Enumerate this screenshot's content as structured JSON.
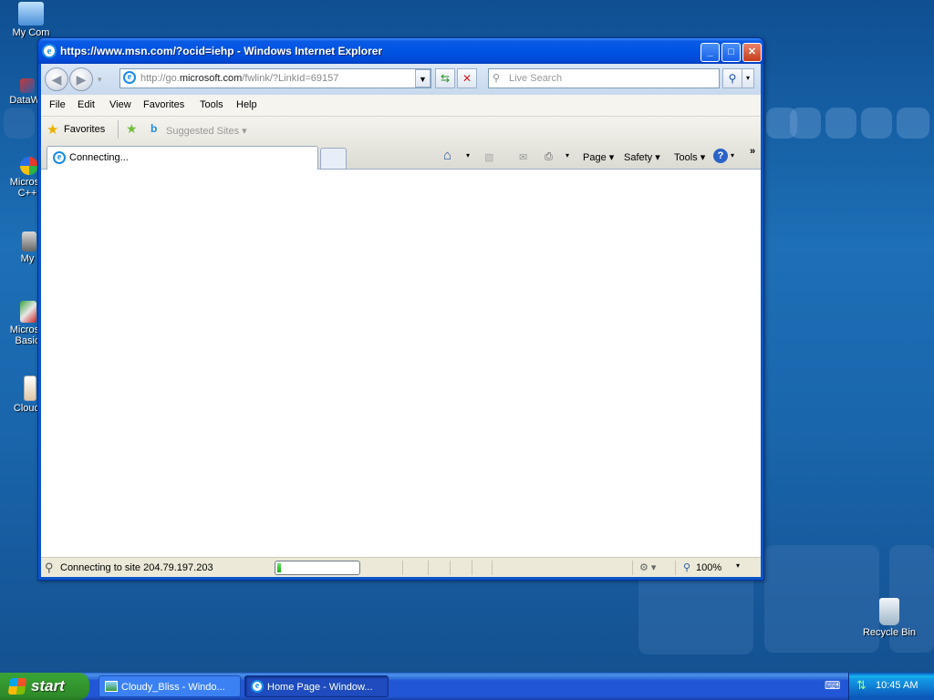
{
  "desktop": {
    "icons": [
      {
        "label": "My Com"
      },
      {
        "label": "DataWa"
      },
      {
        "label": "Microso C++"
      },
      {
        "label": "My"
      },
      {
        "label": "Microso Basic"
      },
      {
        "label": "Cloudy"
      }
    ],
    "recycle_bin": "Recycle Bin"
  },
  "window": {
    "title": "https://www.msn.com/?ocid=iehp - Windows Internet Explorer",
    "address_prefix": "http://go.",
    "address_domain": "microsoft.com",
    "address_suffix": "/fwlink/?LinkId=69157",
    "search_placeholder": "Live Search",
    "menu": [
      "File",
      "Edit",
      "View",
      "Favorites",
      "Tools",
      "Help"
    ],
    "favorites_label": "Favorites",
    "suggested_sites": "Suggested Sites",
    "tab_label": "Connecting...",
    "commands": {
      "page": "Page",
      "safety": "Safety",
      "tools": "Tools"
    },
    "status_text": "Connecting to site 204.79.197.203",
    "progress": 0.05,
    "zoom": "100%"
  },
  "taskbar": {
    "start_label": "start",
    "tasks": [
      {
        "label": "Cloudy_Bliss - Windo..."
      },
      {
        "label": "Home Page - Window..."
      }
    ],
    "clock": "10:45 AM"
  }
}
